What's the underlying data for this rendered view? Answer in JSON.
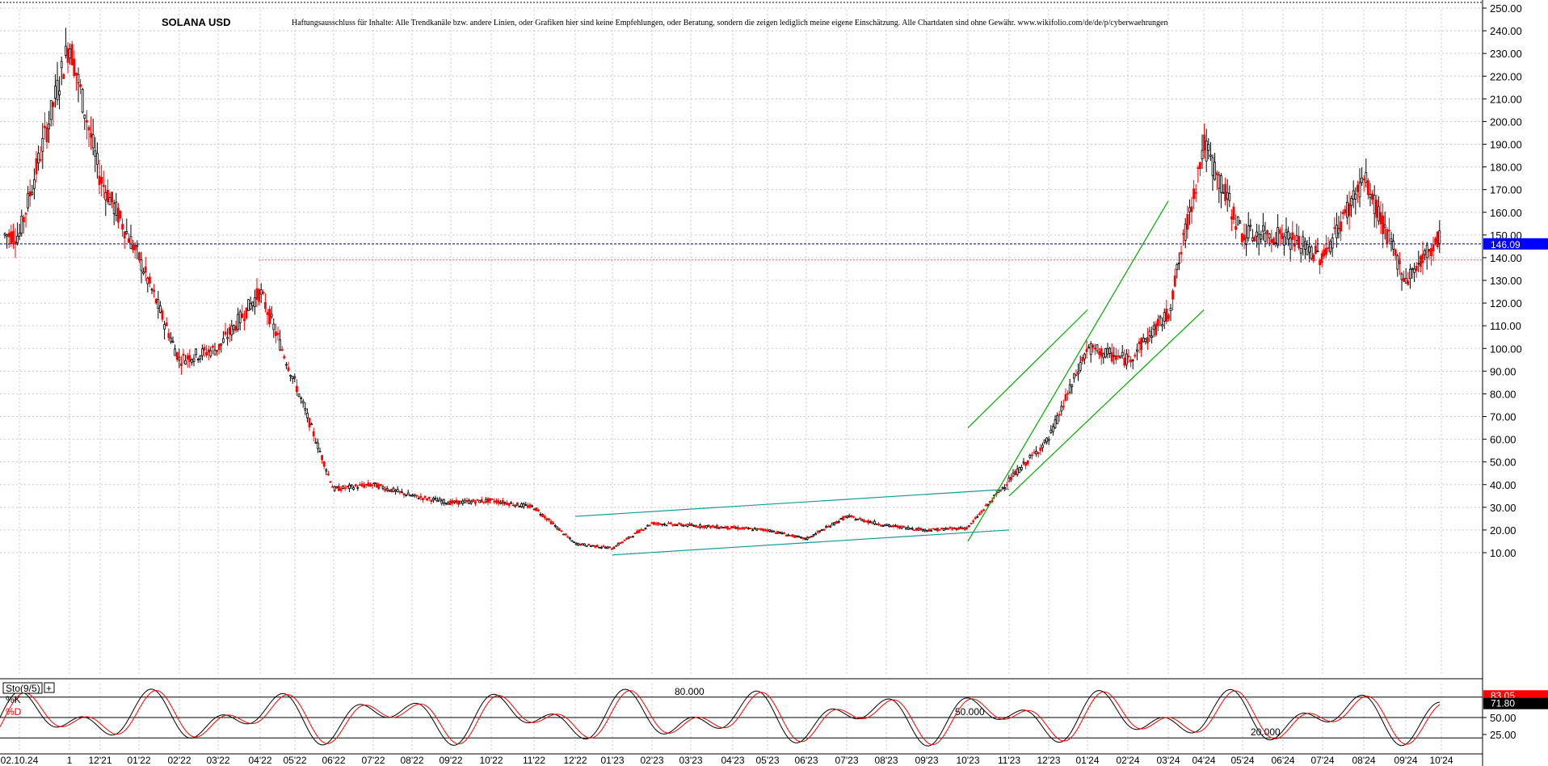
{
  "header": {
    "title": "SOLANA USD",
    "disclaimer": "Haftungsausschluss für Inhalte: Alle Trendkanäle bzw. andere Linien, oder Grafiken hier sind keine Empfehlungen, oder Beratung, sondern die zeigen lediglich meine eigene Einschätzung. Alle Chartdaten sind ohne Gewähr.  www.wikifolio.com/de/de/p/cyberwaehrungen"
  },
  "colors": {
    "up_candle": "#000000",
    "down_candle": "#ff0000",
    "grid": "#c8c8c8",
    "price_line": "#000080",
    "price_badge": "#0000ff",
    "trend_green": "#00aa00",
    "channel_teal": "#139a96",
    "k_line": "#000000",
    "d_line": "#ff0000"
  },
  "chart_data": [
    {
      "type": "candlestick",
      "title": "SOLANA USD",
      "ylim": [
        0,
        255
      ],
      "y_ticks": [
        "250.00",
        "240.00",
        "230.00",
        "220.00",
        "210.00",
        "200.00",
        "190.00",
        "180.00",
        "170.00",
        "160.00",
        "150.00",
        "140.00",
        "130.00",
        "120.00",
        "110.00",
        "100.00",
        "90.00",
        "80.00",
        "70.00",
        "60.00",
        "50.00",
        "40.00",
        "30.00",
        "20.00",
        "10.00"
      ],
      "x_ticks": [
        "02.10.24",
        "1",
        "12'21",
        "01'22",
        "02'22",
        "03'22",
        "04'22",
        "05'22",
        "06'22",
        "07'22",
        "08'22",
        "09'22",
        "10'22",
        "11'22",
        "12'22",
        "01'23",
        "02'23",
        "03'23",
        "04'23",
        "05'23",
        "06'23",
        "07'23",
        "08'23",
        "09'23",
        "10'23",
        "11'23",
        "12'23",
        "01'24",
        "02'24",
        "03'24",
        "04'24",
        "05'24",
        "06'24",
        "07'24",
        "08'24",
        "09'24",
        "10'24"
      ],
      "grid": true,
      "last_price_label": "146.09",
      "last_price": 146.09,
      "reference_level": 139,
      "series": [
        {
          "x": [
            "10'21",
            "11'21",
            "12'21",
            "01'22",
            "02'22",
            "03'22",
            "04'22",
            "05'22",
            "06'22",
            "07'22",
            "08'22",
            "09'22",
            "10'22",
            "11'22",
            "12'22",
            "01'23",
            "02'23",
            "03'23",
            "04'23",
            "05'23",
            "06'23",
            "07'23",
            "08'23",
            "09'23",
            "10'23",
            "11'23",
            "12'23",
            "01'24",
            "02'24",
            "03'24",
            "04'24",
            "05'24",
            "06'24",
            "07'24",
            "08'24",
            "09'24",
            "10'24"
          ],
          "values": [
            150,
            235,
            175,
            140,
            95,
            100,
            125,
            85,
            38,
            40,
            35,
            32,
            33,
            30,
            14,
            12,
            23,
            22,
            21,
            20,
            16,
            26,
            22,
            20,
            21,
            42,
            60,
            100,
            95,
            115,
            190,
            150,
            150,
            140,
            175,
            130,
            150
          ]
        }
      ],
      "trend_lines": [
        {
          "name": "green-channel-upper",
          "from": [
            "10'23",
            65
          ],
          "to": [
            "01'24",
            117
          ]
        },
        {
          "name": "green-channel-mid",
          "from": [
            "10'23",
            15
          ],
          "to": [
            "03'24",
            165
          ]
        },
        {
          "name": "green-channel-lower",
          "from": [
            "11'23",
            35
          ],
          "to": [
            "04'24",
            117
          ]
        },
        {
          "name": "teal-upper",
          "from": [
            "12'22",
            26
          ],
          "to": [
            "11'23",
            38
          ]
        },
        {
          "name": "teal-lower",
          "from": [
            "01'23",
            9
          ],
          "to": [
            "11'23",
            20
          ]
        }
      ]
    },
    {
      "type": "line",
      "title": "Sto(9/5)",
      "ylim": [
        0,
        100
      ],
      "y_ticks": [
        "50.00",
        "25.00"
      ],
      "level_labels": [
        "80.000",
        "50.000",
        "20.000"
      ],
      "levels": [
        80,
        50,
        20
      ],
      "legend": [
        "%K",
        "%D"
      ],
      "k_label": "83.05",
      "d_label": "71.80",
      "series": [
        {
          "name": "%K",
          "last": 83.05
        },
        {
          "name": "%D",
          "last": 71.8
        }
      ]
    }
  ]
}
